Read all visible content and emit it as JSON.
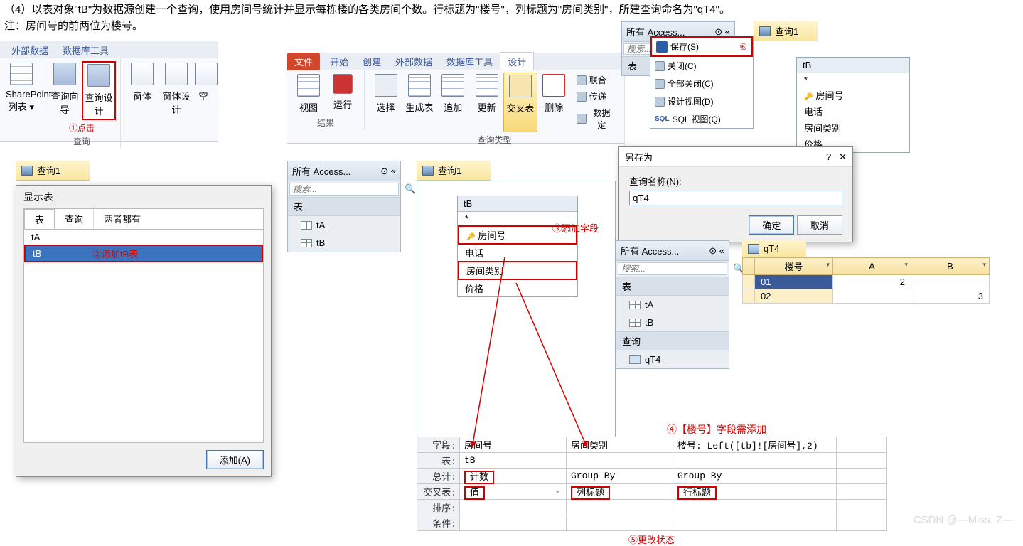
{
  "instruction": {
    "main": "（4）以表对象\"tB\"为数据源创建一个查询，使用房间号统计并显示每栋楼的各类房间个数。行标题为\"楼号\"，列标题为\"房间类别\"，所建查询命名为\"qT4\"。",
    "note": "注：房间号的前两位为楼号。"
  },
  "ribbon1": {
    "tabs": [
      "外部数据",
      "数据库工具"
    ],
    "btns": {
      "sp": "SharePoint",
      "sp2": "列表 ▾",
      "qw": "查询向导",
      "qd": "查询设计",
      "form": "窗体",
      "formd": "窗体设计",
      "blank": "空"
    },
    "group": "查询",
    "ann": "①点击"
  },
  "ribbon2": {
    "tabs": {
      "file": "文件",
      "start": "开始",
      "create": "创建",
      "ext": "外部数据",
      "tools": "数据库工具",
      "design": "设计"
    },
    "btns": {
      "view": "视图",
      "run": "运行",
      "select": "选择",
      "mktbl": "生成表",
      "append": "追加",
      "update": "更新",
      "cross": "交叉表",
      "delete": "删除"
    },
    "side": {
      "union": "联合",
      "pass": "传递",
      "datadef": "数据定"
    },
    "groups": {
      "res": "结果",
      "qt": "查询类型"
    }
  },
  "filemenu": {
    "items": [
      {
        "icon": "save",
        "label": "保存(S)",
        "ann": "⑥"
      },
      {
        "icon": "close",
        "label": "关闭(C)"
      },
      {
        "icon": "closeall",
        "label": "全部关闭(C)"
      },
      {
        "icon": "design",
        "label": "设计视图(D)"
      },
      {
        "icon": "sql",
        "label": "SQL 视图(Q)"
      }
    ]
  },
  "nav_small": {
    "title": "所有 Access..."
  },
  "nav1": {
    "title": "所有 Access...",
    "search": "搜索...",
    "sect": "表",
    "items": [
      "tA",
      "tB"
    ]
  },
  "nav2": {
    "title": "所有 Access...",
    "search": "搜索...",
    "sect1": "表",
    "items1": [
      "tA",
      "tB"
    ],
    "sect2": "查询",
    "items2": [
      "qT4"
    ]
  },
  "query_tab": "查询1",
  "qt4_tab": "qT4",
  "show_table": {
    "title": "显示表",
    "tabs": [
      "表",
      "查询",
      "两者都有"
    ],
    "items": [
      "tA",
      "tB"
    ],
    "ann": "②添加tB表",
    "add": "添加(A)"
  },
  "tB_fields": {
    "title": "tB",
    "star": "*",
    "rows": [
      "房间号",
      "电话",
      "房间类别",
      "价格"
    ],
    "key": "房间号",
    "ann": "③添加字段"
  },
  "saveas": {
    "title": "另存为",
    "label": "查询名称(N):",
    "value": "qT4",
    "ok": "确定",
    "cancel": "取消"
  },
  "grid": {
    "labels": {
      "field": "字段:",
      "table": "表:",
      "total": "总计:",
      "cross": "交叉表:",
      "sort": "排序:",
      "cond": "条件:"
    },
    "col1": {
      "field": "房间号",
      "table": "tB",
      "total": "计数",
      "cross": "值"
    },
    "col2": {
      "field": "房间类别",
      "table": "",
      "total": "Group By",
      "cross": "列标题"
    },
    "col3": {
      "field": "楼号: Left([tb]![房间号],2)",
      "table": "",
      "total": "Group By",
      "cross": "行标题"
    },
    "ann_up": "④【楼号】字段需添加",
    "ann_down": "⑤更改状态"
  },
  "result": {
    "cols": [
      "楼号",
      "A",
      "B"
    ],
    "rows": [
      {
        "k": "01",
        "a": "2",
        "b": ""
      },
      {
        "k": "02",
        "a": "",
        "b": "3"
      }
    ]
  },
  "watermark": "CSDN @—Miss. Z—"
}
